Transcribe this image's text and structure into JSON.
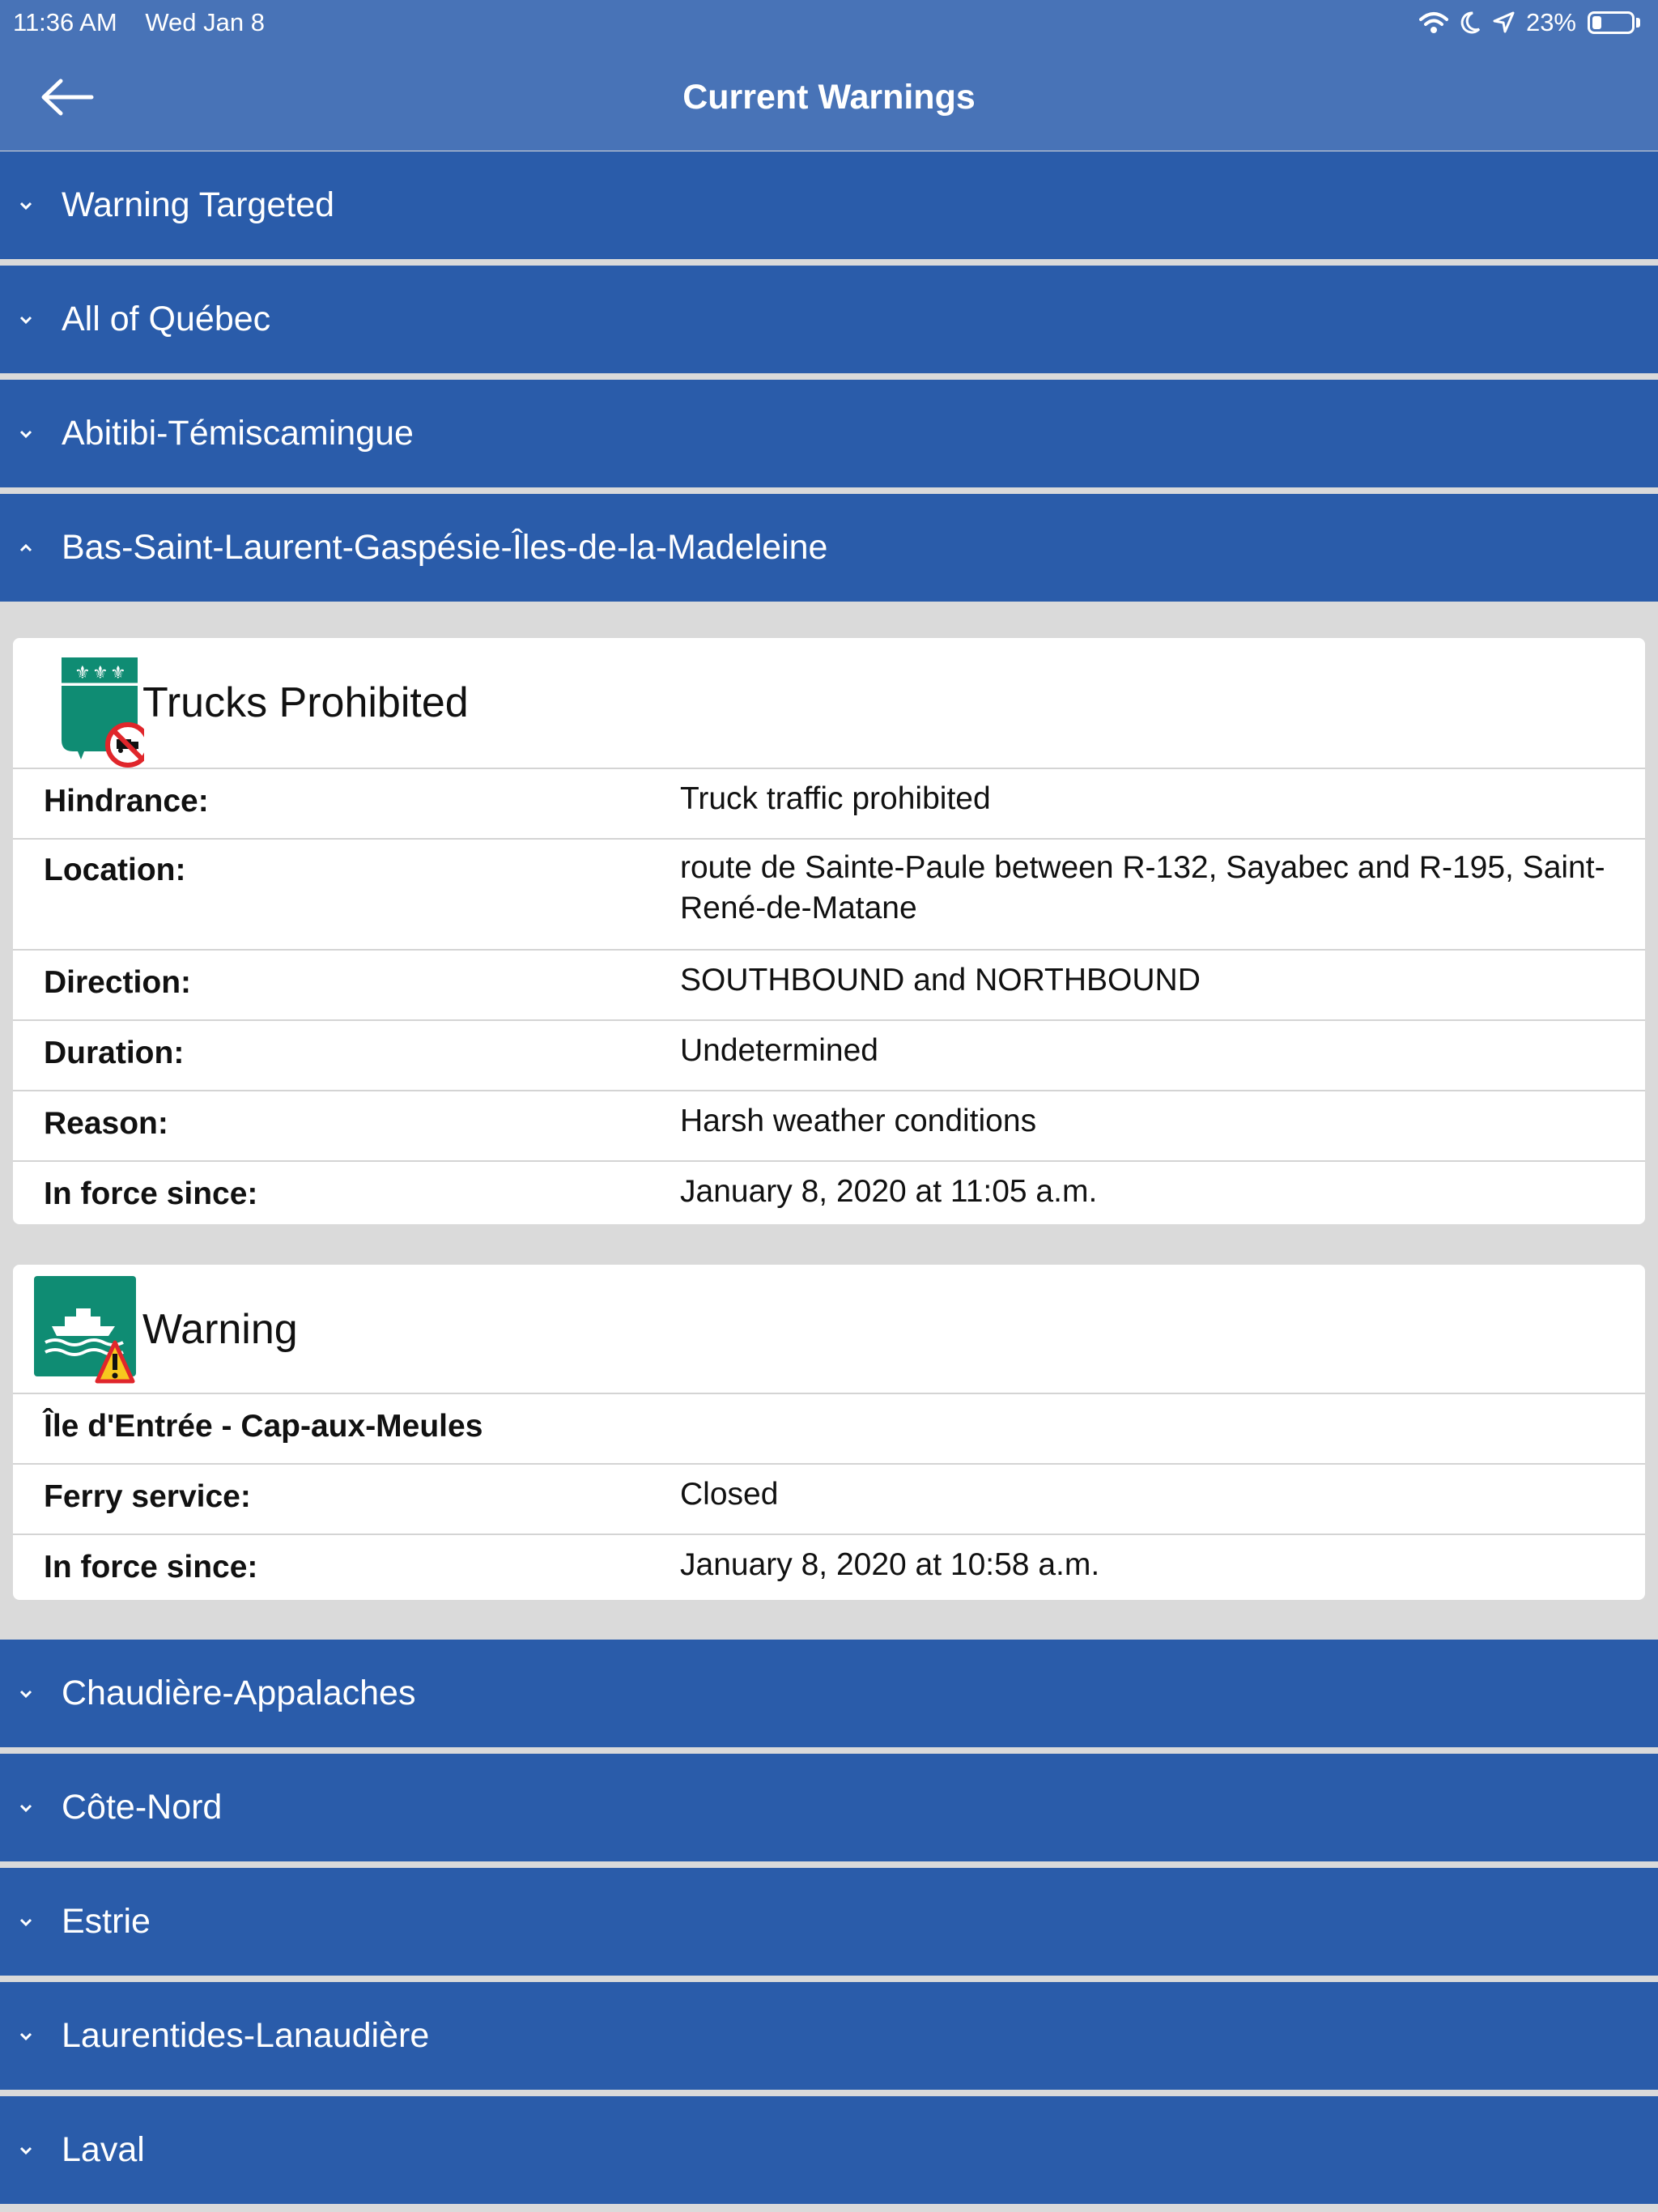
{
  "status_bar": {
    "time": "11:36 AM",
    "date": "Wed Jan 8",
    "battery": "23%",
    "battery_level": 0.23,
    "icons": [
      "wifi-icon",
      "moon-icon",
      "location-arrow-icon",
      "battery-icon"
    ]
  },
  "nav": {
    "back_icon": "arrow-left-icon",
    "title": "Current Warnings"
  },
  "regions_top": [
    {
      "label": "Warning Targeted",
      "expanded": false
    },
    {
      "label": "All of Québec",
      "expanded": false
    },
    {
      "label": "Abitibi-Témiscamingue",
      "expanded": false
    },
    {
      "label": "Bas-Saint-Laurent-Gaspésie-Îles-de-la-Madeleine",
      "expanded": true
    }
  ],
  "cards": [
    {
      "icon": "trucks-prohibited-icon",
      "title": "Trucks Prohibited",
      "rows": [
        {
          "key": "Hindrance:",
          "value": "Truck traffic prohibited"
        },
        {
          "key": "Location:",
          "value": "route de Sainte-Paule between R-132, Sayabec and R-195, Saint-René-de-Matane"
        },
        {
          "key": "Direction:",
          "value": "SOUTHBOUND and NORTHBOUND"
        },
        {
          "key": "Duration:",
          "value": "Undetermined"
        },
        {
          "key": "Reason:",
          "value": "Harsh weather conditions"
        },
        {
          "key": "In force since:",
          "value": "January 8, 2020 at 11:05 a.m."
        }
      ]
    },
    {
      "icon": "ferry-warning-icon",
      "title": "Warning",
      "subtitle": "Île d'Entrée - Cap-aux-Meules",
      "rows": [
        {
          "key": "Ferry service:",
          "value": "Closed"
        },
        {
          "key": "In force since:",
          "value": "January 8, 2020 at 10:58 a.m."
        }
      ]
    }
  ],
  "regions_bottom": [
    {
      "label": "Chaudière-Appalaches",
      "expanded": false
    },
    {
      "label": "Côte-Nord",
      "expanded": false
    },
    {
      "label": "Estrie",
      "expanded": false
    },
    {
      "label": "Laurentides-Lanaudière",
      "expanded": false
    },
    {
      "label": "Laval",
      "expanded": false
    }
  ],
  "colors": {
    "nav_bar": "#4873b7",
    "region_row": "#2a5caa",
    "background": "#dadada",
    "icon_green": "#0f8c73",
    "prohibited_red": "#e0262b",
    "warning_yellow": "#f7c81e"
  }
}
